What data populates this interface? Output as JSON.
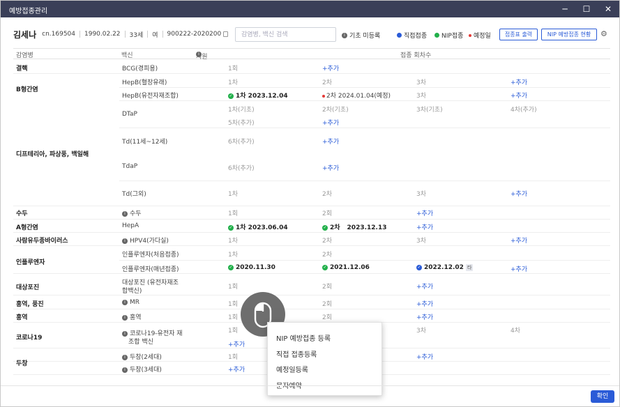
{
  "window": {
    "title": "예방접종관리"
  },
  "patient": {
    "name": "김세나",
    "chart": "cn.169504",
    "dob": "1990.02.22",
    "age": "33세",
    "sex": "여",
    "id": "900222-2020200"
  },
  "search": {
    "placeholder": "감염병, 백신 검색"
  },
  "legend": {
    "unreg": "기초 미등록",
    "direct": "직접접종",
    "nip": "NIP접종",
    "planned": "예정일"
  },
  "buttons": {
    "print": "접종표 출력",
    "nip_status": "NIP 예방접종 현황",
    "ok": "확인"
  },
  "table": {
    "h_disease": "감염병",
    "h_vaccine": "백신",
    "h_support": "지원",
    "h_count": "접종 회차수"
  },
  "colors": {
    "accent": "#2a5bd7",
    "done": "#22b04b",
    "planned": "#e53935",
    "direct": "#2a5bd7"
  },
  "diseases": [
    {
      "name": "결핵"
    },
    {
      "name": "B형간염"
    },
    {
      "name": "디프테리아, 파상풍, 백일해"
    },
    {
      "name": "수두"
    },
    {
      "name": "A형간염"
    },
    {
      "name": "사람유두종바이러스"
    },
    {
      "name": "인플루엔자"
    },
    {
      "name": "대상포진"
    },
    {
      "name": "홍역, 풍진"
    },
    {
      "name": "홍역"
    },
    {
      "name": "코로나19"
    },
    {
      "name": "두창"
    }
  ],
  "vaccines": [
    {
      "name": "BCG(경피용)"
    },
    {
      "name": "HepB(혈장유래)"
    },
    {
      "name": "HepB(유전자재조합)"
    },
    {
      "name": "DTaP"
    },
    {
      "name": "Td(11세~12세)"
    },
    {
      "name": "TdaP"
    },
    {
      "name": "Td(그외)"
    },
    {
      "name": "수두"
    },
    {
      "name": "HepA"
    },
    {
      "name": "HPV4(가다실)"
    },
    {
      "name": "인플루엔자(처음접종)"
    },
    {
      "name": "인플루엔자(매년접종)"
    },
    {
      "name": "대상포진 (유전자재조"
    },
    {
      "name": "합백신)"
    },
    {
      "name": "MR"
    },
    {
      "name": "홍역"
    },
    {
      "name": "코로나19-유전자 재"
    },
    {
      "name": "조합 백신"
    },
    {
      "name": "두창(2세대)"
    },
    {
      "name": "두창(3세대)"
    }
  ],
  "doses": {
    "d1": "1회",
    "d2": "2회",
    "c1": "1차",
    "c2": "2차",
    "c3": "3차",
    "c4": "4차",
    "b1": "1차(기초)",
    "b2": "2차(기초)",
    "b3": "3차(기초)",
    "a4": "4차(추가)",
    "a5": "5차(추가)",
    "a6": "6차(추가)",
    "add": "+추가",
    "hepb1": "1차 2023.12.04",
    "hepb2": "2차 2024.01.04(예정)",
    "hepa1": "1차 2023.06.04",
    "hepa2": "2차",
    "hepa2d": "2023.12.13",
    "flu1": "2020.11.30",
    "flu2": "2021.12.06",
    "flu3": "2022.12.02",
    "flu3tag": "타"
  },
  "context_menu": {
    "items": [
      "NIP 예방접종 등록",
      "직접 접종등록",
      "예정일등록",
      "문자예약"
    ]
  }
}
